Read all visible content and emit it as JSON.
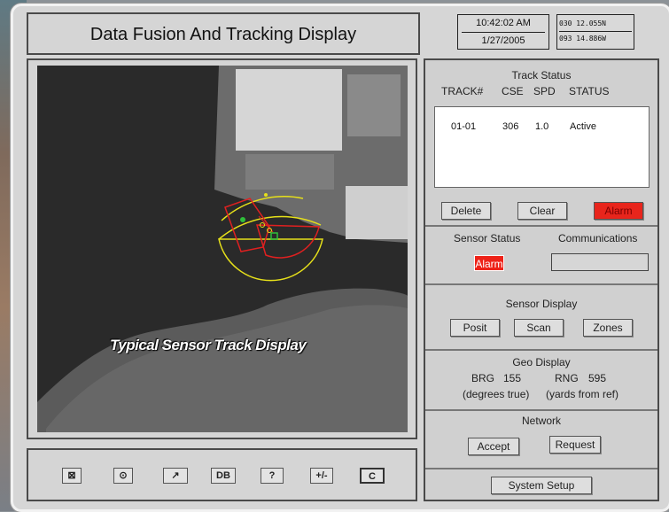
{
  "title": "Data Fusion And Tracking Display",
  "clock": {
    "time": "10:42:02 AM",
    "date": "1/27/2005"
  },
  "position": {
    "lat": "030  12.055N",
    "lon": "093  14.886W"
  },
  "map": {
    "caption": "Typical Sensor Track Display"
  },
  "toolbar": {
    "buttons": [
      {
        "name": "close-box-button",
        "label": "⊠"
      },
      {
        "name": "target-button",
        "label": "⊙"
      },
      {
        "name": "arrow-button",
        "label": "↗"
      },
      {
        "name": "db-button",
        "label": "DB"
      },
      {
        "name": "help-button",
        "label": "?"
      },
      {
        "name": "plus-minus-button",
        "label": "+/-"
      },
      {
        "name": "c-button",
        "label": "C"
      }
    ]
  },
  "track_status": {
    "title": "Track Status",
    "columns": [
      "TRACK#",
      "CSE",
      "SPD",
      "STATUS"
    ],
    "rows": [
      {
        "track": "01-01",
        "cse": "306",
        "spd": "1.0",
        "status": "Active"
      }
    ],
    "buttons": {
      "delete": "Delete",
      "clear": "Clear",
      "alarm": "Alarm"
    }
  },
  "sensor_status": {
    "title": "Sensor Status",
    "indicator": "Alarm"
  },
  "communications": {
    "title": "Communications",
    "value": ""
  },
  "sensor_display": {
    "title": "Sensor Display",
    "buttons": [
      "Posit",
      "Scan",
      "Zones"
    ]
  },
  "geo_display": {
    "title": "Geo Display",
    "brg_label": "BRG",
    "brg_value": "155",
    "rng_label": "RNG",
    "rng_value": "595",
    "brg_unit": "(degrees true)",
    "rng_unit": "(yards from ref)"
  },
  "network": {
    "title": "Network",
    "accept": "Accept",
    "request": "Request"
  },
  "system_setup": {
    "label": "System Setup"
  },
  "colors": {
    "alarm_red": "#e8251c",
    "track_yellow": "#e6e01a",
    "zone_red": "#e02020",
    "track_green": "#2fbf3a"
  }
}
